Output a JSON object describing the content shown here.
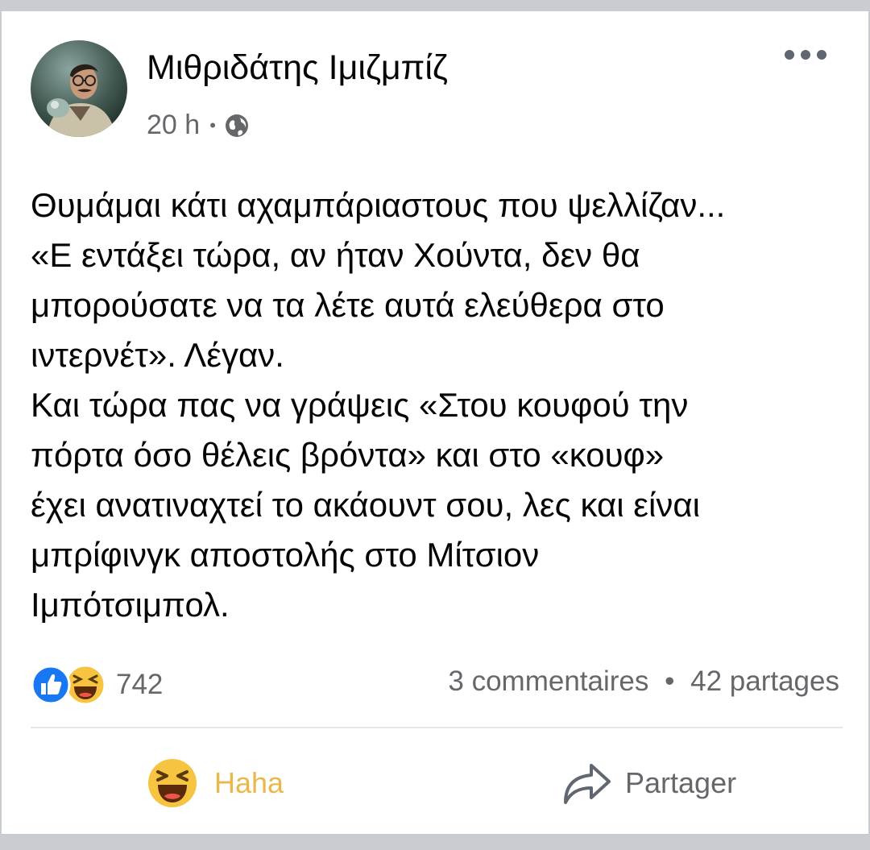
{
  "post": {
    "author": "Μιθριδάτης Ιμιζμπίζ",
    "time": "20 h",
    "separator": "•",
    "privacy_icon": "globe-icon",
    "text_lines": [
      "Θυμάμαι κάτι αχαμπάριαστους που ψελλίζαν...",
      "«Ε εντάξει τώρα, αν ήταν Χούντα, δεν θα",
      "μπορούσατε να τα λέτε αυτά ελεύθερα στο",
      "ιντερνέτ». Λέγαν.",
      "Και τώρα πας να γράψεις «Στου κουφού την",
      "πόρτα όσο θέλεις βρόντα» και στο «κουφ»",
      "έχει ανατιναχτεί το ακάουντ σου, λες και είναι",
      "μπρίφινγκ αποστολής στο Μίτσιον",
      "Ιμπότσιμπολ."
    ]
  },
  "reactions": {
    "icons": [
      "like-icon",
      "haha-icon"
    ],
    "count": "742",
    "comments": "3 commentaires",
    "separator": "•",
    "shares": "42 partages"
  },
  "actions": {
    "haha_label": "Haha",
    "share_label": "Partager"
  },
  "colors": {
    "like_blue": "#1877f2",
    "haha_yellow": "#f7c441",
    "haha_label": "#e9b84a",
    "secondary_text": "#65676b"
  }
}
